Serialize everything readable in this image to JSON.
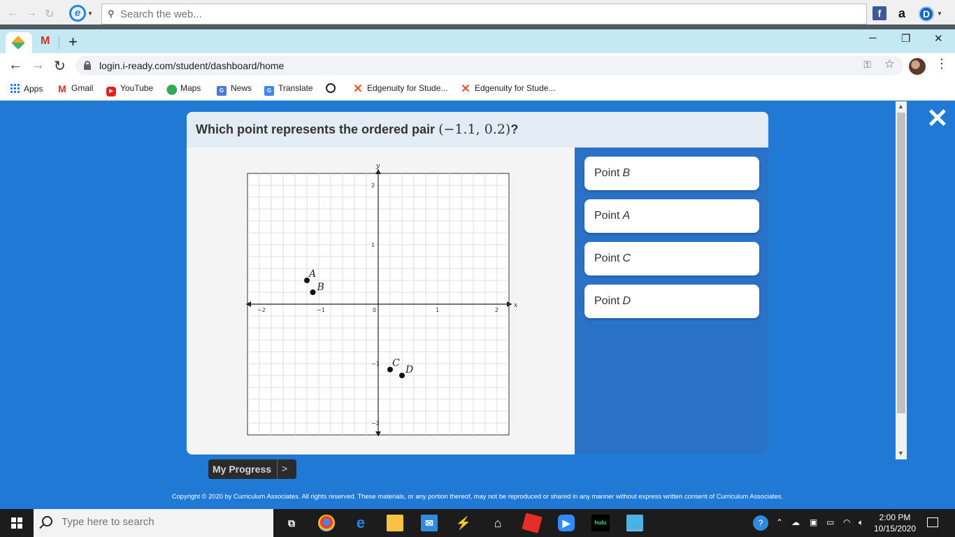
{
  "ie_toolbar": {
    "search_placeholder": "Search the web...",
    "extensions": [
      "f",
      "a",
      "D"
    ]
  },
  "tabs": {
    "new_tab_label": "+",
    "gmail_icon": "M"
  },
  "window_controls": {
    "minimize": "─",
    "restore": "❐",
    "close": "✕"
  },
  "address_bar": {
    "url": "login.i-ready.com/student/dashboard/home"
  },
  "bookmarks": [
    {
      "icon": "apps-icon",
      "label": "Apps"
    },
    {
      "icon": "gmail-icon",
      "label": "Gmail"
    },
    {
      "icon": "youtube-icon",
      "label": "YouTube"
    },
    {
      "icon": "maps-icon",
      "label": "Maps"
    },
    {
      "icon": "news-icon",
      "label": "News"
    },
    {
      "icon": "translate-icon",
      "label": "Translate"
    },
    {
      "icon": "globe-icon",
      "label": ""
    },
    {
      "icon": "edgenuity-icon",
      "label": "Edgenuity for Stude..."
    },
    {
      "icon": "edgenuity-icon",
      "label": "Edgenuity for Stude..."
    }
  ],
  "question": {
    "prompt": "Which point represents the ordered pair",
    "pair": "(−1.1, 0.2)",
    "suffix": "?"
  },
  "graph": {
    "x_axis_label": "x",
    "y_axis_label": "y",
    "x_range": [
      -2.2,
      2.2
    ],
    "y_range": [
      -2.2,
      2.2
    ],
    "grid_step": 0.2,
    "x_ticks": [
      {
        "value": -2,
        "label": "−2"
      },
      {
        "value": -1,
        "label": "−1"
      },
      {
        "value": 1,
        "label": "1"
      },
      {
        "value": 2,
        "label": "2"
      }
    ],
    "y_ticks": [
      {
        "value": 2,
        "label": "2"
      },
      {
        "value": 1,
        "label": "1"
      },
      {
        "value": -1,
        "label": "−1"
      },
      {
        "value": -2,
        "label": "−2"
      }
    ],
    "origin_label": "0",
    "points": [
      {
        "name": "A",
        "x": -1.2,
        "y": 0.4
      },
      {
        "name": "B",
        "x": -1.1,
        "y": 0.2
      },
      {
        "name": "C",
        "x": 0.2,
        "y": -1.1
      },
      {
        "name": "D",
        "x": 0.4,
        "y": -1.2
      }
    ]
  },
  "answers": [
    {
      "word": "Point",
      "var": "B"
    },
    {
      "word": "Point",
      "var": "A"
    },
    {
      "word": "Point",
      "var": "C"
    },
    {
      "word": "Point",
      "var": "D"
    }
  ],
  "close_label": "✕",
  "my_progress": {
    "label": "My Progress",
    "arrow": ">"
  },
  "copyright": "Copyright © 2020 by Curriculum Associates. All rights reserved. These materials, or any portion thereof, may not be reproduced or shared in any manner without express written consent of Curriculum Associates.",
  "taskbar": {
    "search_placeholder": "Type here to search",
    "time": "2:00 PM",
    "date": "10/15/2020",
    "hulu_label": "hulu"
  }
}
